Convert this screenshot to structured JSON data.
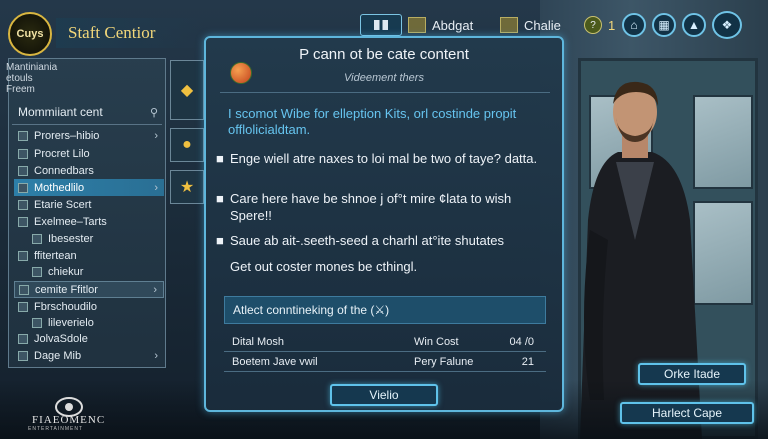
{
  "app": {
    "badge_text": "Cuys",
    "title": "Staft Centior"
  },
  "topbar": {
    "item1_label": "Abdgat",
    "item2_label": "Chalie",
    "count_label": "1",
    "count_icon_text": "?"
  },
  "sidebar": {
    "header_lines": [
      "Mantiniania",
      "etouls",
      "Freem"
    ],
    "search_label": "Mommiiant cent",
    "search_icon": "search-icon",
    "items": [
      {
        "label": "Prorers–hibio",
        "chevron": true
      },
      {
        "label": "Procret Lilo",
        "chevron": false
      },
      {
        "label": "Connedbars",
        "chevron": false
      },
      {
        "label": "Mothedlilo",
        "chevron": true,
        "active": true
      },
      {
        "label": "Etarie Scert",
        "chevron": false
      },
      {
        "label": "Exelmee–Tarts",
        "chevron": false
      },
      {
        "label": "Ibesester",
        "chevron": false
      },
      {
        "label": "ffitertean",
        "chevron": false
      },
      {
        "label": "chiekur",
        "chevron": false
      },
      {
        "label": "cemite Ffitlor",
        "chevron": true,
        "selected": true
      },
      {
        "label": "Fbrschoudilo",
        "chevron": false
      },
      {
        "label": "lileverielo",
        "chevron": false
      },
      {
        "label": "JolvaSdole",
        "chevron": false
      },
      {
        "label": "Dage Mib",
        "chevron": true
      }
    ]
  },
  "dialog": {
    "title": "P cann ot be cate content",
    "subtitle": "Videement thers",
    "intro": "I scomot Wibe for elleption Kits, orl costinde propit offlolicialdtam.",
    "bullets": [
      "Enge wiell atre naxes to loi mal be two of taye? datta.",
      "Care here have be shnoe j of°t mire ¢lata to wish Spere!!",
      "Saue ab ait-.seeth-seed a charhl at°ite shutates"
    ],
    "closing": "Get out coster mones be cthingl.",
    "table_header": "Atlect conntineking of the (⚔)",
    "rows": [
      {
        "name": "Dital Mosh",
        "col2": "Win Cost",
        "col3": "04 /0"
      },
      {
        "name": "Boetem Jave vwil",
        "col2": "Pery Falune",
        "col3": "21"
      }
    ],
    "button_label": "Vielio"
  },
  "right_buttons": {
    "top_label": "Orke Itade",
    "bottom_label": "Harlect Cape"
  },
  "brand": {
    "name": "FIAEOMENC",
    "tagline": "ENTERTAINMENT"
  },
  "colors": {
    "accent": "#5eb6dc",
    "gold": "#f2d77a",
    "active_item": "#2d7fa8",
    "intro_text": "#66c4ef"
  }
}
